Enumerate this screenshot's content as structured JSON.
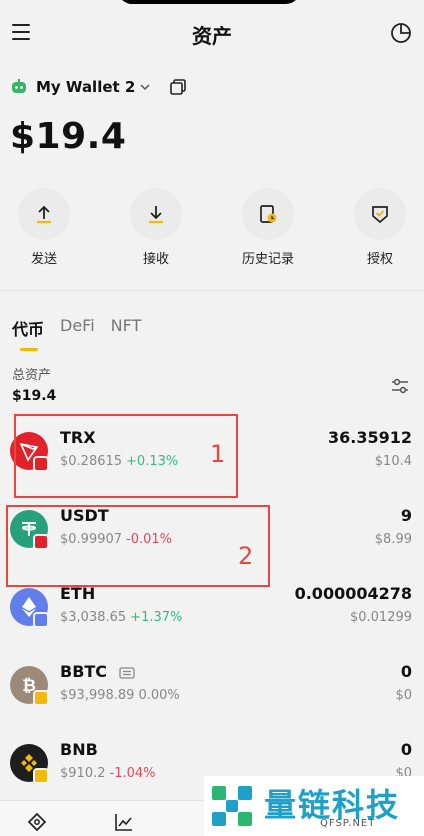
{
  "header": {
    "title": "资产"
  },
  "wallet": {
    "name": "My Wallet 2"
  },
  "balance": "$19.4",
  "actions": [
    {
      "label": "发送",
      "icon": "send-icon"
    },
    {
      "label": "接收",
      "icon": "receive-icon"
    },
    {
      "label": "历史记录",
      "icon": "history-icon"
    },
    {
      "label": "授权",
      "icon": "authorize-icon"
    }
  ],
  "tabs": [
    {
      "label": "代币",
      "active": true
    },
    {
      "label": "DeFi",
      "active": false
    },
    {
      "label": "NFT",
      "active": false
    }
  ],
  "total": {
    "label": "总资产",
    "value": "$19.4"
  },
  "tokens": [
    {
      "symbol": "TRX",
      "price": "$0.28615",
      "change": "+0.13%",
      "amount": "36.35912",
      "fiat": "$10.4",
      "color": "#e2222b"
    },
    {
      "symbol": "USDT",
      "price": "$0.99907",
      "change": "-0.01%",
      "amount": "9",
      "fiat": "$8.99",
      "color": "#26a17b"
    },
    {
      "symbol": "ETH",
      "price": "$3,038.65",
      "change": "+1.37%",
      "amount": "0.000004278",
      "fiat": "$0.01299",
      "color": "#627eea"
    },
    {
      "symbol": "BBTC",
      "price": "$93,998.89",
      "change": "0.00%",
      "amount": "0",
      "fiat": "$0",
      "color": "#9b8a78"
    },
    {
      "symbol": "BNB",
      "price": "$910.2",
      "change": "-1.04%",
      "amount": "0",
      "fiat": "$0",
      "color": "#f0b90b"
    }
  ],
  "annotations": [
    "1",
    "2"
  ],
  "watermark": {
    "title": "量链科技",
    "subtitle": "QFSP.NET"
  },
  "colors": {
    "accent": "#f0b90b",
    "up": "#2ebd85",
    "down": "#e04a58",
    "annotation": "#e8473f"
  }
}
